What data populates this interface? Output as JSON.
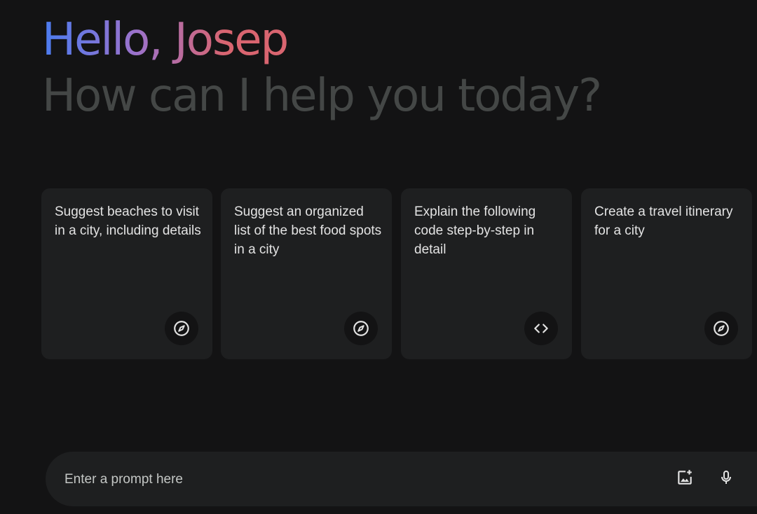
{
  "greeting": {
    "prefix": "Hello, ",
    "name": "Josep"
  },
  "subtitle": "How can I help you today?",
  "cards": [
    {
      "text": "Suggest beaches to visit in a city, including details",
      "icon": "compass-icon"
    },
    {
      "text": "Suggest an organized list of the best food spots in a city",
      "icon": "compass-icon"
    },
    {
      "text": "Explain the following code step-by-step in detail",
      "icon": "code-icon"
    },
    {
      "text": "Create a travel itinerary for a city",
      "icon": "compass-icon"
    }
  ],
  "prompt": {
    "placeholder": "Enter a prompt here",
    "value": ""
  },
  "tools": {
    "image_icon": "add-image-icon",
    "mic_icon": "microphone-icon"
  },
  "colors": {
    "background": "#131314",
    "surface": "#1e1f20",
    "text": "#e3e3e3",
    "muted": "#444746",
    "gradient_blue": "#4a7cf0",
    "gradient_purple": "#9b72cb",
    "gradient_red": "#d96570"
  }
}
